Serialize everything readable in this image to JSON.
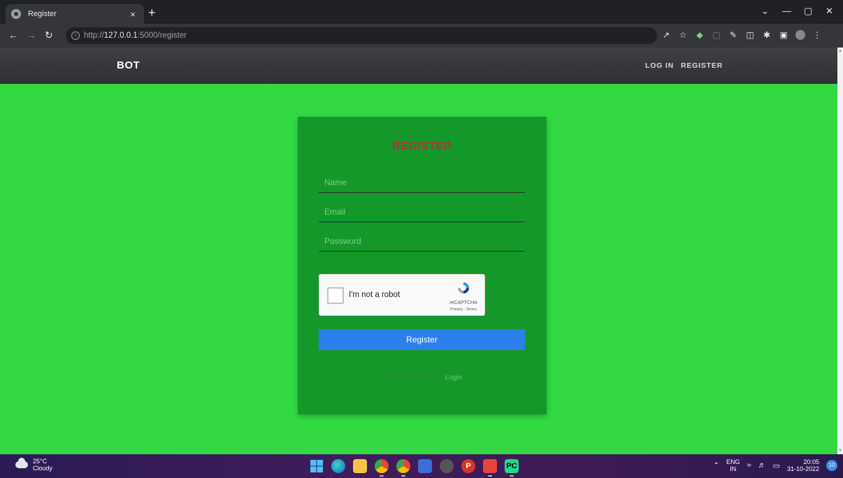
{
  "browser": {
    "tab_title": "Register",
    "tab_close": "×",
    "new_tab": "+",
    "url_prefix": "http://",
    "url_host": "127.0.0.1",
    "url_rest": ":5000/register",
    "window_controls": [
      "⌄",
      "—",
      "▢",
      "✕"
    ]
  },
  "site": {
    "brand": "BOT",
    "nav": {
      "login": "LOG IN",
      "register": "REGISTER"
    }
  },
  "form": {
    "title": "REGISTER",
    "name_placeholder": "Name",
    "email_placeholder": "Email",
    "password_placeholder": "Password",
    "recaptcha": {
      "label": "I'm not a robot",
      "brand": "reCAPTCHA",
      "links": "Privacy - Terms"
    },
    "submit_label": "Register",
    "footer_text": "Already a member?",
    "footer_link": "Login"
  },
  "taskbar": {
    "weather_temp": "25°C",
    "weather_desc": "Cloudy",
    "lang": "ENG",
    "region": "IN",
    "time": "20:05",
    "date": "31-10-2022",
    "notifications": "10"
  },
  "colors": {
    "page_bg": "#32d943",
    "card_bg": "#15982a",
    "title": "#b0323a",
    "button": "#2d7fea"
  }
}
